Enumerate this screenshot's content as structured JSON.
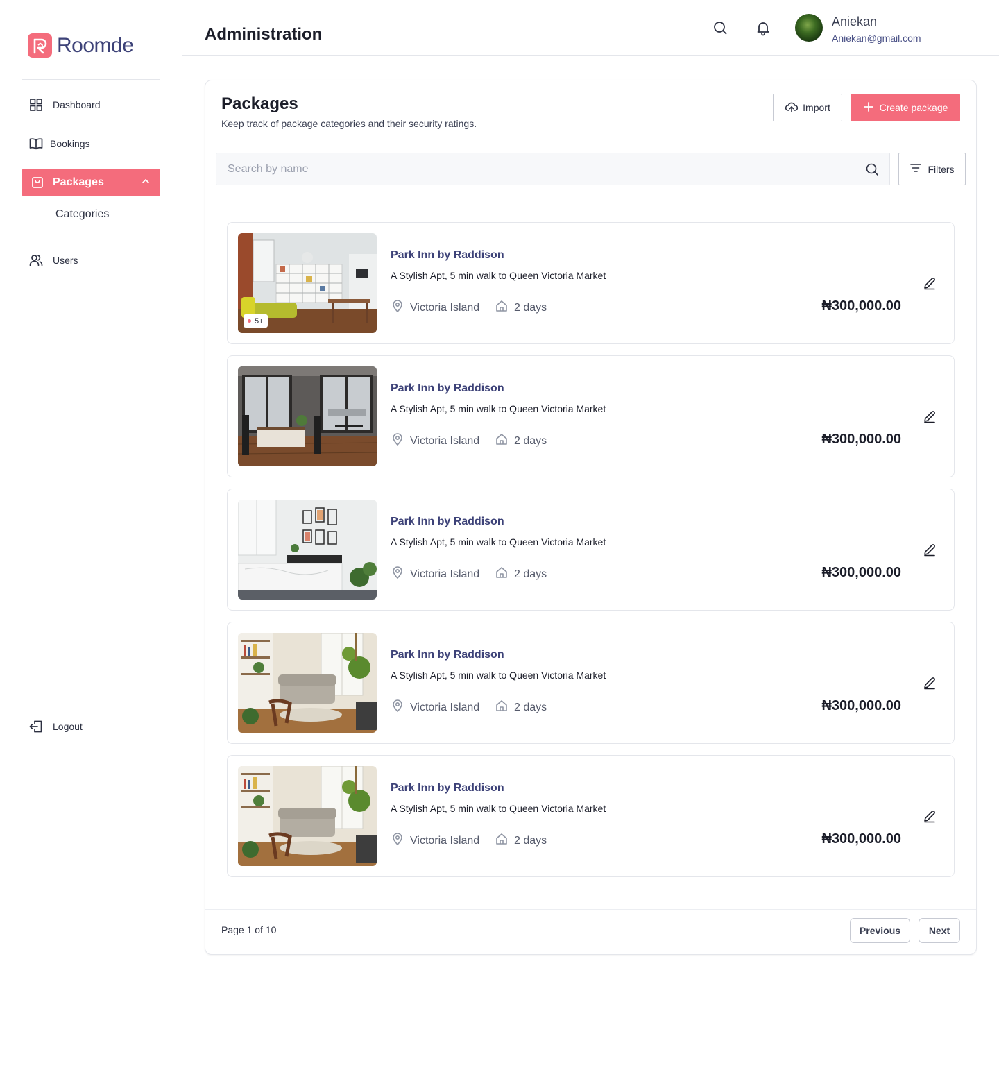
{
  "brand": {
    "name": "Roomde",
    "accent": "#f46c7c",
    "navy": "#3d4278"
  },
  "sidebar": {
    "items": [
      {
        "label": "Dashboard",
        "icon": "grid-icon"
      },
      {
        "label": "Bookings",
        "icon": "book-icon"
      },
      {
        "label": "Packages",
        "icon": "bag-icon",
        "active": true
      },
      {
        "label": "Users",
        "icon": "users-icon"
      }
    ],
    "sub_items": [
      {
        "label": "Categories"
      }
    ],
    "logout_label": "Logout"
  },
  "header": {
    "title": "Administration",
    "user": {
      "name": "Aniekan",
      "email": "Aniekan@gmail.com"
    }
  },
  "packages_panel": {
    "title": "Packages",
    "subtitle": "Keep track of package categories and their security ratings.",
    "import_label": "Import",
    "create_label": "Create package",
    "search_placeholder": "Search by name",
    "filters_label": "Filters"
  },
  "packages": [
    {
      "name": "Park Inn by Raddison",
      "description": "A Stylish Apt, 5 min walk to Queen Victoria Market",
      "location": "Victoria Island",
      "duration": "2 days",
      "price": "₦300,000.00",
      "badge": "5+"
    },
    {
      "name": "Park Inn by Raddison",
      "description": "A Stylish Apt, 5 min walk to Queen Victoria Market",
      "location": "Victoria Island",
      "duration": "2 days",
      "price": "₦300,000.00"
    },
    {
      "name": "Park Inn by Raddison",
      "description": "A Stylish Apt, 5 min walk to Queen Victoria Market",
      "location": "Victoria Island",
      "duration": "2 days",
      "price": "₦300,000.00"
    },
    {
      "name": "Park Inn by Raddison",
      "description": "A Stylish Apt, 5 min walk to Queen Victoria Market",
      "location": "Victoria Island",
      "duration": "2 days",
      "price": "₦300,000.00"
    },
    {
      "name": "Park Inn by Raddison",
      "description": "A Stylish Apt, 5 min walk to Queen Victoria Market",
      "location": "Victoria Island",
      "duration": "2 days",
      "price": "₦300,000.00"
    }
  ],
  "pagination": {
    "text": "Page 1 of 10",
    "previous_label": "Previous",
    "next_label": "Next"
  }
}
